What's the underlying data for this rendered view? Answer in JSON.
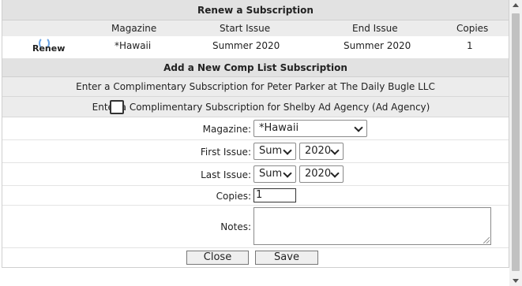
{
  "renew_section": {
    "title": "Renew a Subscription",
    "columns": [
      "Magazine",
      "Start Issue",
      "End Issue",
      "Copies"
    ],
    "row": {
      "action": "Renew",
      "magazine": "*Hawaii",
      "start_issue": "Summer 2020",
      "end_issue": "Summer 2020",
      "copies": "1"
    }
  },
  "new_comp_section": {
    "title": "Add a New Comp List Subscription",
    "option_1": "Enter a Complimentary Subscription for Peter Parker at The Daily Bugle LLC",
    "option_2": "Enter a Complimentary Subscription for Shelby Ad Agency (Ad Agency)",
    "option_2_checked": false
  },
  "form": {
    "magazine_label": "Magazine:",
    "magazine_value": "*Hawaii",
    "first_issue_label": "First Issue:",
    "first_issue_season": "Sum",
    "first_issue_year": "2020",
    "last_issue_label": "Last Issue:",
    "last_issue_season": "Sum",
    "last_issue_year": "2020",
    "copies_label": "Copies:",
    "copies_value": "1",
    "notes_label": "Notes:",
    "notes_value": ""
  },
  "buttons": {
    "close": "Close",
    "save": "Save"
  },
  "colors": {
    "header_bg": "#e2e2e2",
    "band_bg": "#ececec",
    "renew_icon": "#6aa4e6"
  }
}
